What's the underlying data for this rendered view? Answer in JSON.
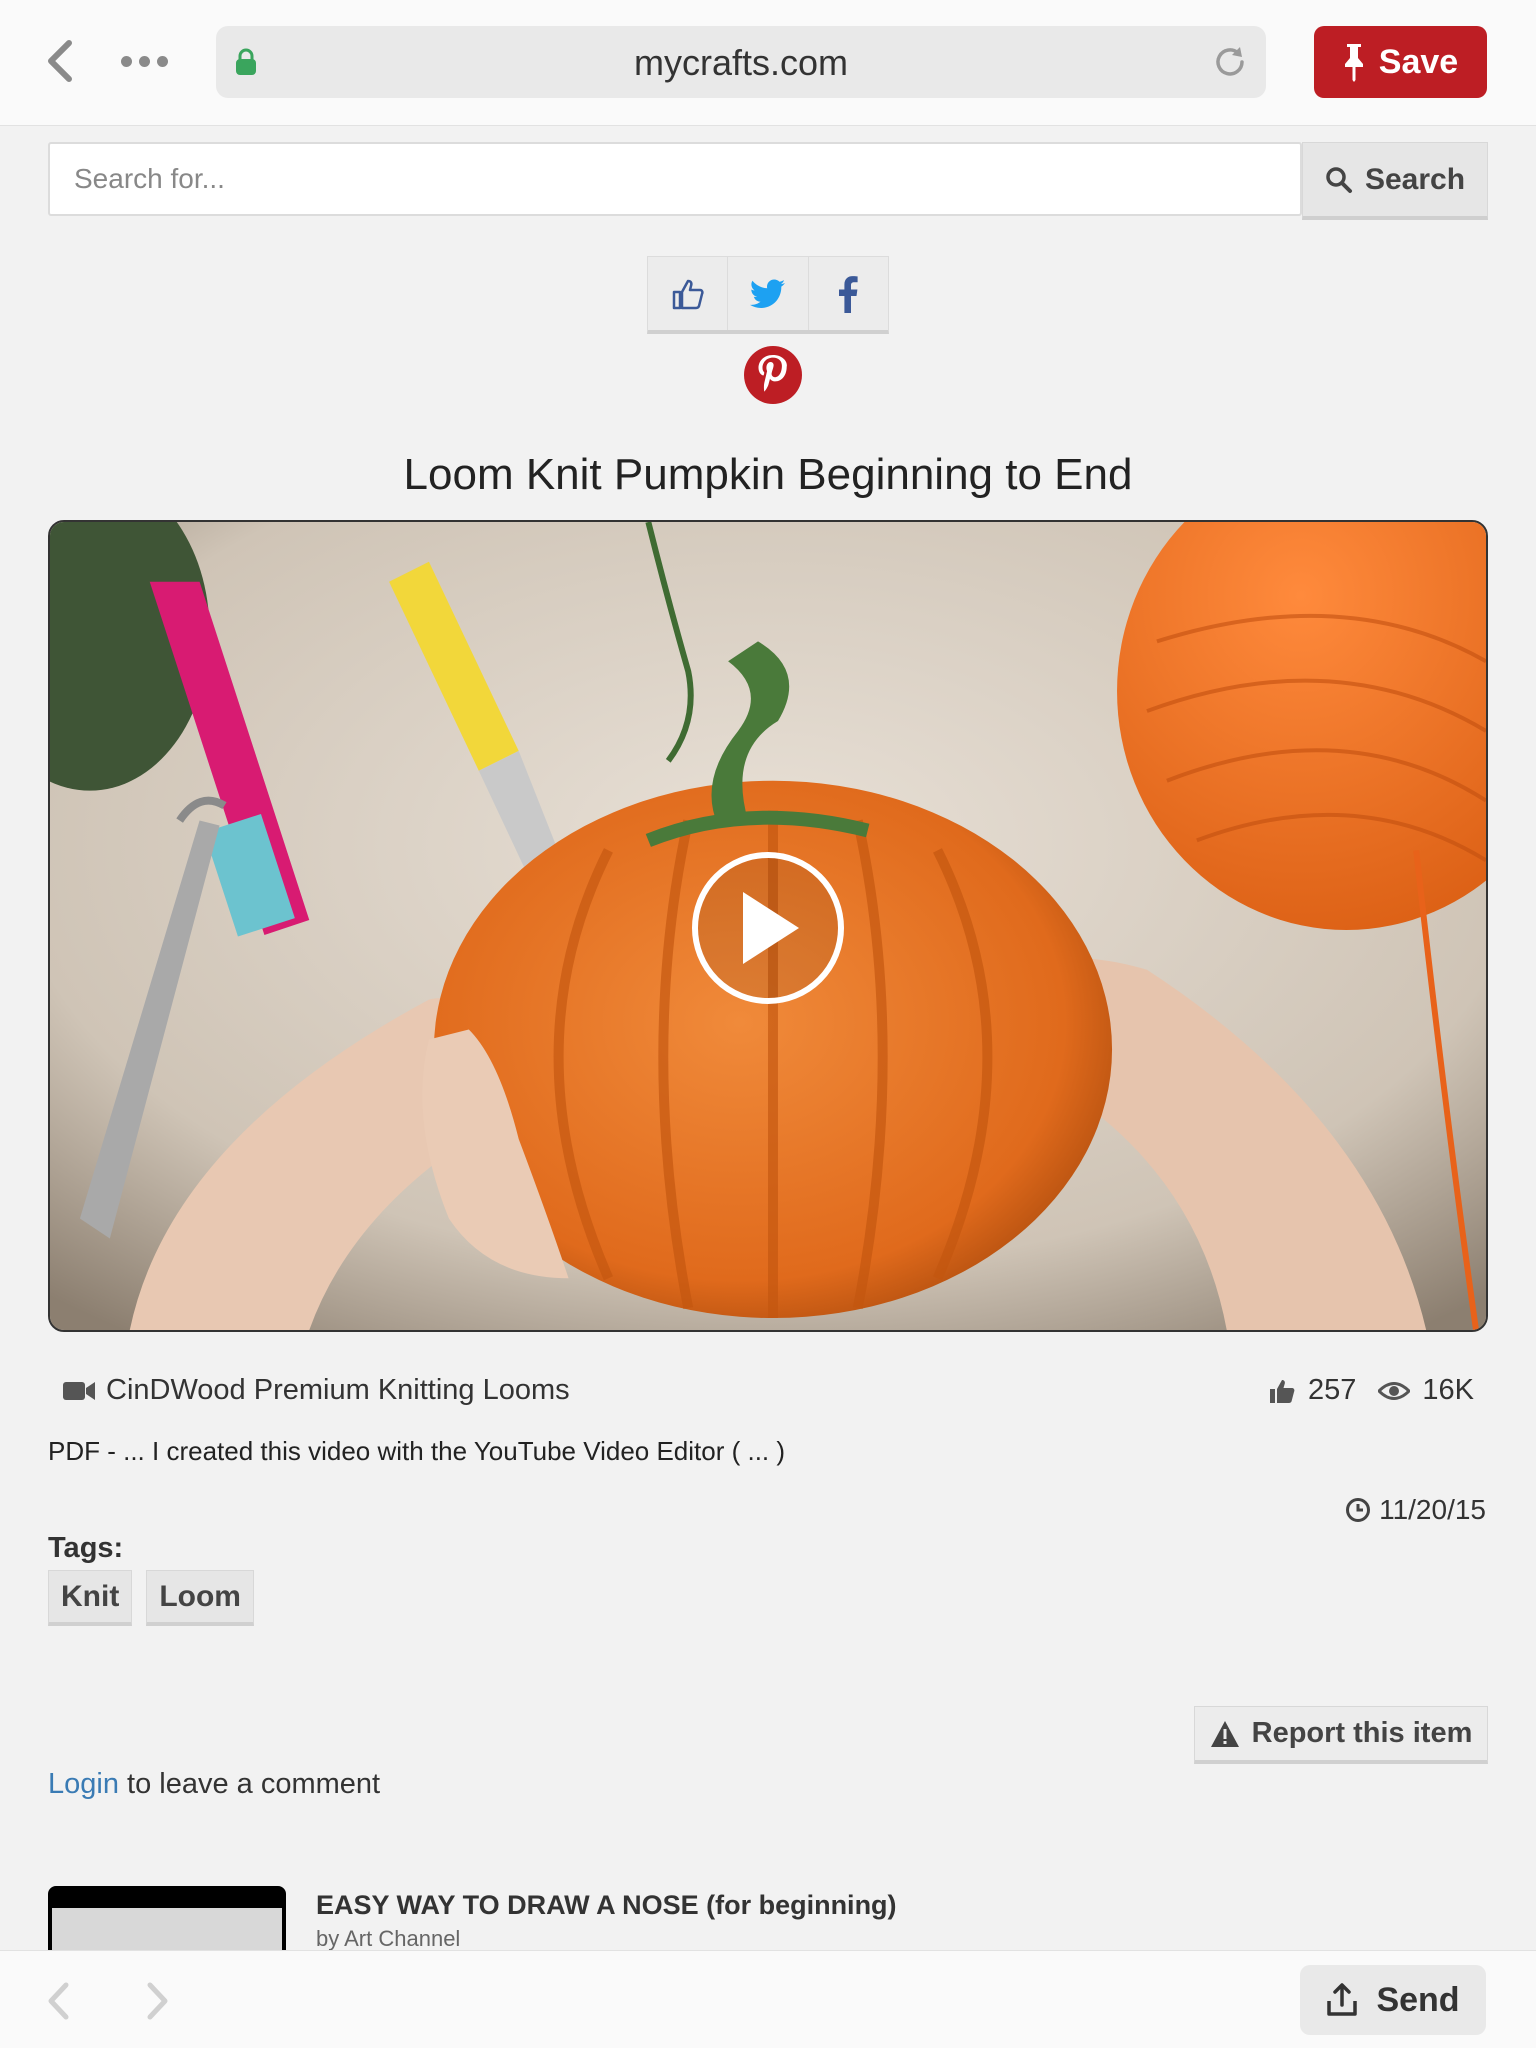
{
  "browser": {
    "url": "mycrafts.com",
    "save_label": "Save"
  },
  "search": {
    "placeholder": "Search for...",
    "button_label": "Search"
  },
  "video": {
    "title": "Loom Knit Pumpkin Beginning to End",
    "channel": "CinDWood Premium Knitting Looms",
    "likes": "257",
    "views": "16K",
    "description": "PDF -  ...  I created this video with the YouTube Video Editor ( ... )",
    "date": "11/20/15"
  },
  "tags": {
    "label": "Tags:",
    "items": [
      "Knit",
      "Loom"
    ]
  },
  "report_label": "Report this item",
  "comment": {
    "login_link": "Login",
    "rest": " to leave a comment"
  },
  "related": {
    "title": "EASY WAY TO DRAW A NOSE (for beginning)",
    "by": "by Art Channel"
  },
  "bottom": {
    "send_label": "Send"
  },
  "colors": {
    "save_red": "#bd1e24",
    "link_blue": "#3a7bb4",
    "twitter_blue": "#1da1f2",
    "facebook_blue": "#3b5998"
  }
}
